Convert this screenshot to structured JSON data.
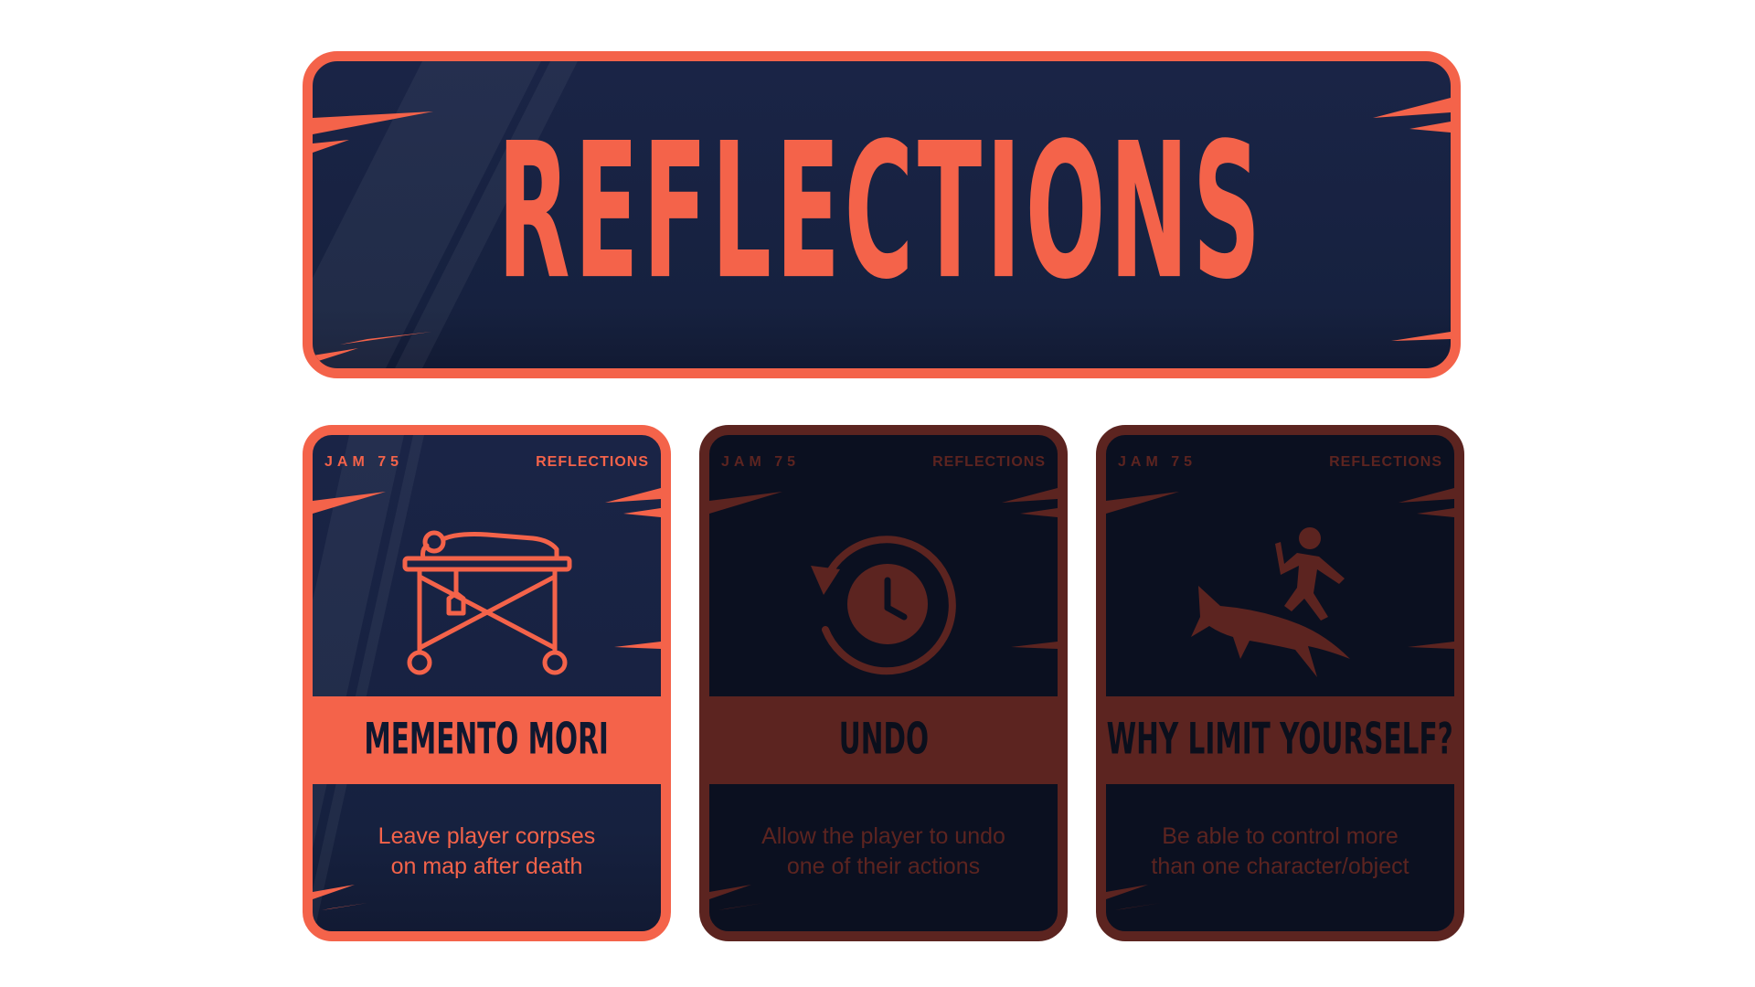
{
  "banner": {
    "title": "REFLECTIONS"
  },
  "colors": {
    "accent": "#f4634a",
    "accent_dim": "#5c2420",
    "panel": "#16213f",
    "panel_dim": "#0b1020",
    "background": "#ffffff"
  },
  "cards": [
    {
      "tag_left": "JAM 75",
      "tag_right": "REFLECTIONS",
      "title": "MEMENTO MORI",
      "desc_line1": "Leave player corpses",
      "desc_line2": "on map after death",
      "icon": "stretcher-body-icon",
      "state": "active"
    },
    {
      "tag_left": "JAM 75",
      "tag_right": "REFLECTIONS",
      "title": "UNDO",
      "desc_line1": "Allow the player to undo",
      "desc_line2": "one of their actions",
      "icon": "clock-rewind-icon",
      "state": "dimmed"
    },
    {
      "tag_left": "JAM 75",
      "tag_right": "REFLECTIONS",
      "title": "WHY LIMIT YOURSELF?",
      "desc_line1": "Be able to control more",
      "desc_line2": "than one character/object",
      "icon": "person-riding-shark-icon",
      "state": "dimmed"
    }
  ]
}
